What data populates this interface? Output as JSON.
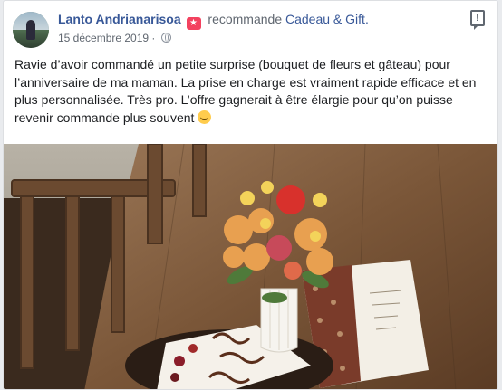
{
  "post": {
    "author": "Lanto Andrianarisoa",
    "action": "recommande",
    "page": "Cadeau & Gift.",
    "date": "15 décembre 2019 ·",
    "text": "Ravie d’avoir commandé un petite surprise (bouquet de fleurs et gâteau) pour l’anniversaire de ma maman. La prise en charge est vraiment rapide efficace et en plus personnalisée. Très pro. L’offre gagnerait à être élargie pour qu’on puisse revenir commande plus souvent",
    "report_glyph": "!",
    "recommend_glyph": "★"
  },
  "icons": {
    "avatar": "profile-photo",
    "recommend": "recommend-star-icon",
    "privacy": "globe-icon",
    "report": "report-icon",
    "emoji": "smiling-face-emoji"
  },
  "colors": {
    "link": "#385898",
    "text": "#1c1e21",
    "meta": "#606770",
    "recommend": "#f3425f"
  }
}
